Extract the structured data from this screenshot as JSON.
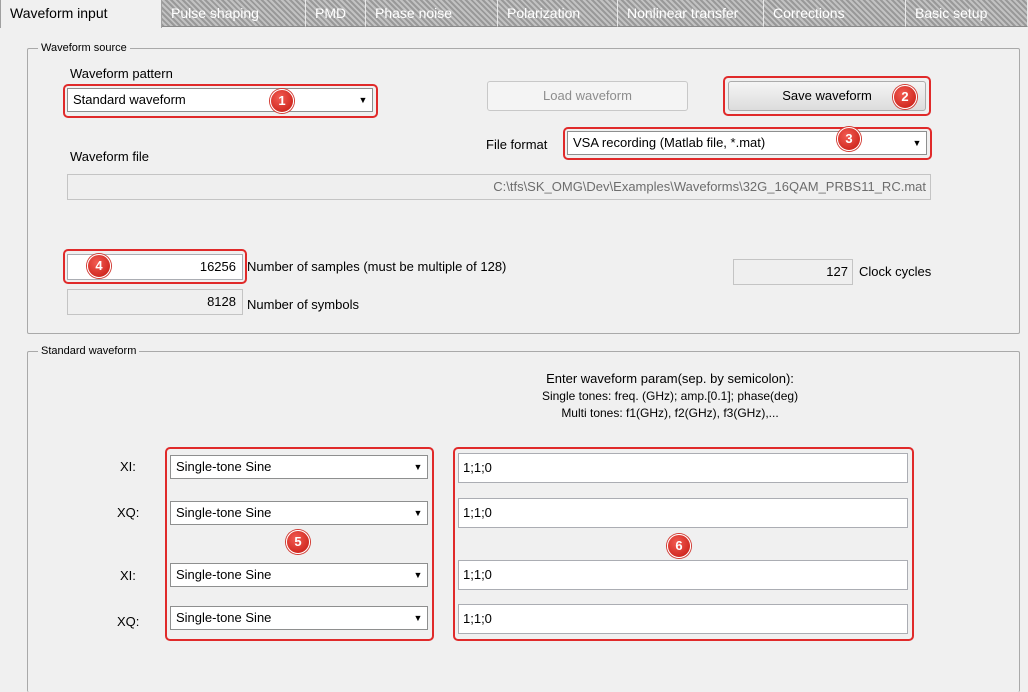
{
  "tabs": [
    "Waveform input",
    "Pulse shaping",
    "PMD",
    "Phase noise",
    "Polarization",
    "Nonlinear transfer",
    "Corrections",
    "Basic setup"
  ],
  "waveform_source": {
    "legend": "Waveform source",
    "pattern_label": "Waveform pattern",
    "pattern_value": "Standard waveform",
    "load_button": "Load waveform",
    "save_button": "Save waveform",
    "file_format_label": "File format",
    "file_format_value": "VSA recording (Matlab file, *.mat)",
    "waveform_file_label": "Waveform file",
    "waveform_file_value": "C:\\tfs\\SK_OMG\\Dev\\Examples\\Waveforms\\32G_16QAM_PRBS11_RC.mat",
    "num_samples_value": "16256",
    "num_samples_label": "Number of samples (must be multiple of 128)",
    "clock_cycles_value": "127",
    "clock_cycles_label": "Clock cycles",
    "num_symbols_value": "8128",
    "num_symbols_label": "Number of symbols"
  },
  "standard_waveform": {
    "legend": "Standard waveform",
    "help_line1": "Enter waveform param(sep. by semicolon):",
    "help_line2": "Single tones: freq. (GHz); amp.[0.1]; phase(deg)",
    "help_line3": "Multi tones: f1(GHz), f2(GHz), f3(GHz),...",
    "rows": [
      {
        "label": "XI:",
        "type": "Single-tone Sine",
        "param": "1;1;0"
      },
      {
        "label": "XQ:",
        "type": "Single-tone Sine",
        "param": "1;1;0"
      },
      {
        "label": "XI:",
        "type": "Single-tone Sine",
        "param": "1;1;0"
      },
      {
        "label": "XQ:",
        "type": "Single-tone Sine",
        "param": "1;1;0"
      }
    ]
  },
  "badges": [
    "1",
    "2",
    "3",
    "4",
    "5",
    "6"
  ],
  "colors": {
    "highlight": "#e02a2a",
    "badge": "#d9251c",
    "background": "#f0f0f0"
  }
}
